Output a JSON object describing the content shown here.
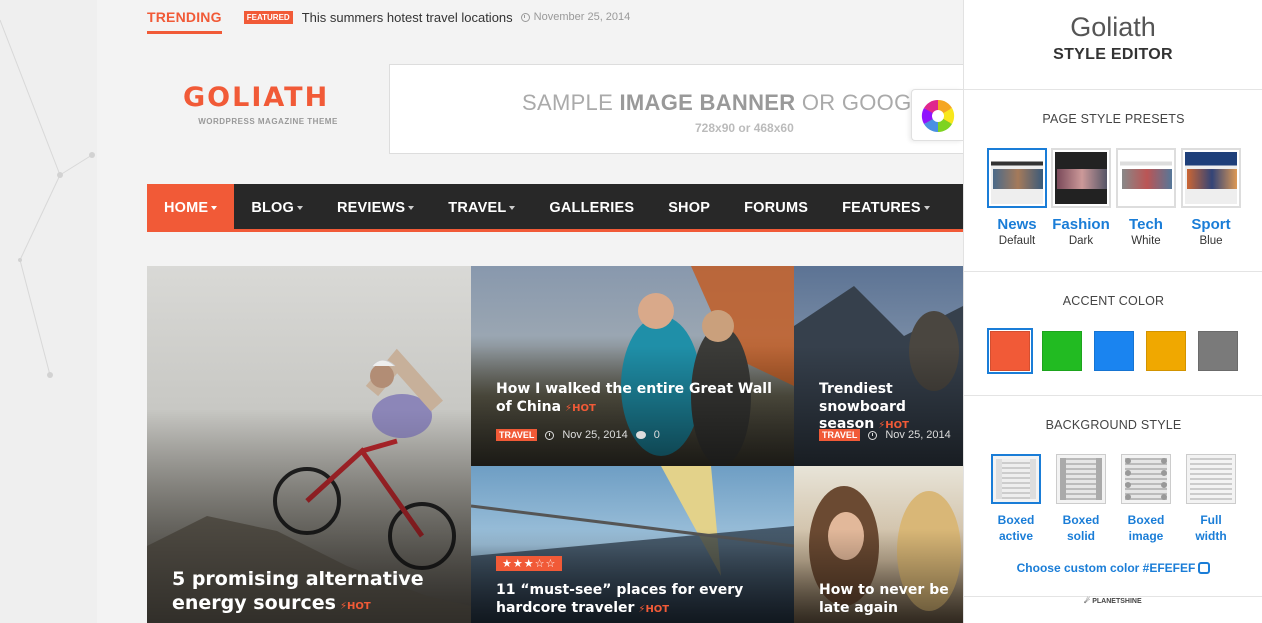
{
  "trending": {
    "label": "TRENDING",
    "badge": "FEATURED",
    "headline": "This summers hotest travel locations",
    "date": "November 25, 2014"
  },
  "header": {
    "logo": "GOLIATH",
    "tagline": "WORDPRESS MAGAZINE THEME",
    "banner_main_1": "SAMPLE ",
    "banner_main_2": "IMAGE BANNER",
    "banner_main_3": " OR GOOG",
    "banner_sub": "728x90 or 468x60"
  },
  "nav": {
    "items": [
      {
        "label": "HOME",
        "dropdown": true,
        "active": true
      },
      {
        "label": "BLOG",
        "dropdown": true
      },
      {
        "label": "REVIEWS",
        "dropdown": true
      },
      {
        "label": "TRAVEL",
        "dropdown": true
      },
      {
        "label": "GALLERIES",
        "dropdown": false
      },
      {
        "label": "SHOP",
        "dropdown": false
      },
      {
        "label": "FORUMS",
        "dropdown": false
      },
      {
        "label": "FEATURES",
        "dropdown": true
      }
    ]
  },
  "articles": [
    {
      "title": "5 promising alternative energy sources",
      "hot": "HOT"
    },
    {
      "title": "How I walked the entire Great Wall of China",
      "hot": "HOT",
      "category": "TRAVEL",
      "date": "Nov 25, 2014",
      "comments": "0"
    },
    {
      "title": "Trendiest snowboard season",
      "hot": "HOT",
      "category": "TRAVEL",
      "date": "Nov 25, 2014"
    },
    {
      "title": "11 “must-see” places for every hardcore traveler",
      "hot": "HOT",
      "stars": "★★★☆☆",
      "rating": 3
    },
    {
      "title": "How to never be late again"
    }
  ],
  "editor": {
    "title": "Goliath",
    "subtitle": "STYLE EDITOR",
    "presets_heading": "PAGE STYLE PRESETS",
    "presets": [
      {
        "name": "News",
        "style": "Default"
      },
      {
        "name": "Fashion",
        "style": "Dark"
      },
      {
        "name": "Tech",
        "style": "White"
      },
      {
        "name": "Sport",
        "style": "Blue"
      }
    ],
    "accent_heading": "ACCENT COLOR",
    "accent_colors": [
      "#f15a37",
      "#22bb22",
      "#1a84f0",
      "#f0a800",
      "#7a7a7a"
    ],
    "background_heading": "BACKGROUND STYLE",
    "backgrounds": [
      {
        "line1": "Boxed",
        "line2": "active"
      },
      {
        "line1": "Boxed",
        "line2": "solid"
      },
      {
        "line1": "Boxed",
        "line2": "image"
      },
      {
        "line1": "Full",
        "line2": "width"
      }
    ],
    "custom_color_label": "Choose custom color #EFEFEF",
    "credit": "PLANETSHINE"
  },
  "colors": {
    "accent": "#f15a37",
    "link": "#1a7dd7",
    "nav_bg": "#282828"
  }
}
